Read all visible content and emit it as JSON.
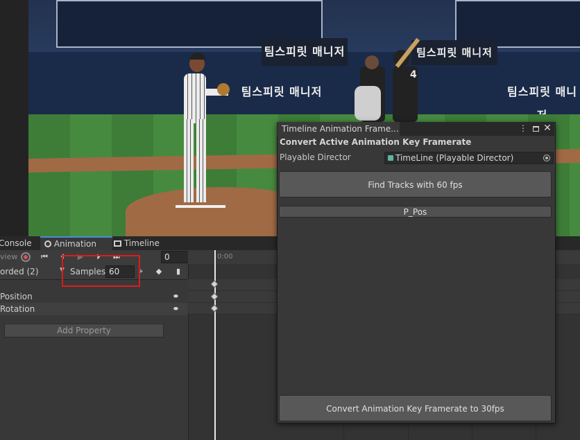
{
  "scene": {
    "banners": [
      "팀스피릿 매니저",
      "팀스피릿 매니저",
      "팀스피릿 매니저",
      "팀스피릿 매니저"
    ],
    "jersey_number": "4"
  },
  "tabs": [
    {
      "label": "Console",
      "icon": "console-icon"
    },
    {
      "label": "Animation",
      "icon": "clock-icon"
    },
    {
      "label": "Timeline",
      "icon": "film-icon"
    }
  ],
  "toolbar": {
    "preview_label": "view",
    "frame_value": "0",
    "recorded_label": "orded (2)",
    "samples_label": "Samples",
    "samples_value": "60"
  },
  "ruler": {
    "time_label": "0:00"
  },
  "properties": [
    {
      "label": "Position"
    },
    {
      "label": "Rotation"
    }
  ],
  "add_property_label": "Add Property",
  "window": {
    "tab_title": "Timeline Animation Frame...",
    "subtitle": "Convert Active Animation Key Framerate",
    "playable_director_label": "Playable Director",
    "playable_director_value": "TimeLine (Playable Director)",
    "find_tracks_label": "Find Tracks with 60 fps",
    "track_name": "P_Pos",
    "convert_label": "Convert Animation Key Framerate to 30fps"
  },
  "colors": {
    "highlight_box": "#e01a1a",
    "active_tab_accent": "#4a8bd6",
    "record_button": "#d9534f"
  }
}
